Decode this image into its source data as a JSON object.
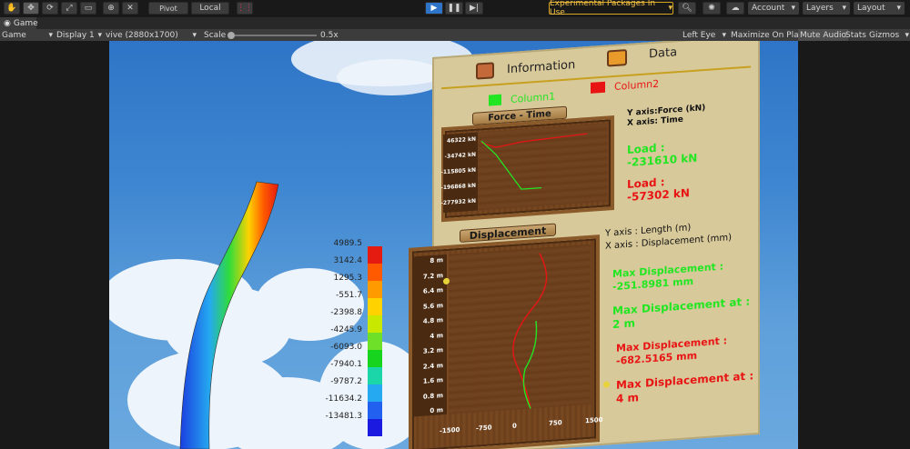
{
  "toolbar": {
    "pivot_label": "Pivot",
    "local_label": "Local",
    "packages_badge": "Experimental Packages In Use",
    "account_label": "Account",
    "layers_label": "Layers",
    "layout_label": "Layout"
  },
  "tab": {
    "label": "Game"
  },
  "gamebar": {
    "view_select": "Game",
    "display_select": "Display 1",
    "resolution_select": "vive (2880x1700)",
    "scale_label": "Scale",
    "scale_value": "0.5x",
    "eye_select": "Left Eye",
    "maximize_label": "Maximize On Play",
    "mute_label": "Mute Audio",
    "stats_label": "Stats",
    "gizmos_label": "Gizmos"
  },
  "legend": {
    "values": [
      "4989.5",
      "3142.4",
      "1295.3",
      "-551.7",
      "-2398.8",
      "-4245.9",
      "-6093.0",
      "-7940.1",
      "-9787.2",
      "-11634.2",
      "-13481.3"
    ],
    "colors": [
      "#e51b12",
      "#ff5a00",
      "#ff9a00",
      "#ffd200",
      "#c8e800",
      "#6fe02a",
      "#17d51e",
      "#1bd6a8",
      "#25a9f0",
      "#2261f0",
      "#1a1ae0"
    ]
  },
  "board": {
    "info_tab": "Information",
    "data_tab": "Data",
    "column1": "Column1",
    "column2": "Column2",
    "force_title": "Force - Time",
    "force_axes_y": "Y axis:Force (kN)",
    "force_axes_x": "X axis: Time",
    "force_ticks": [
      "46322 kN",
      "-34742 kN",
      "-115805 kN",
      "-196868 kN",
      "-277932 kN"
    ],
    "load1_label": "Load :",
    "load1_value": "-231610 kN",
    "load2_label": "Load :",
    "load2_value": "-57302 kN",
    "disp_title": "Displacement",
    "disp_axes_y": "Y axis : Length (m)",
    "disp_axes_x": "X axis : Displacement (mm)",
    "disp_yticks": [
      "8 m",
      "7.2 m",
      "6.4 m",
      "5.6 m",
      "4.8 m",
      "4 m",
      "3.2 m",
      "2.4 m",
      "1.6 m",
      "0.8 m",
      "0 m"
    ],
    "disp_xticks": [
      "-1500",
      "-750",
      "0",
      "750",
      "1500"
    ],
    "maxdisp1_label": "Max Displacement :",
    "maxdisp1_value": "-251.8981 mm",
    "maxat1_label": "Max Displacement at :",
    "maxat1_value": "2 m",
    "maxdisp2_label": "Max Displacement :",
    "maxdisp2_value": "-682.5165 mm",
    "maxat2_label": "Max Displacement at :",
    "maxat2_value": "4 m",
    "green": "#22e622",
    "red": "#e81414"
  }
}
